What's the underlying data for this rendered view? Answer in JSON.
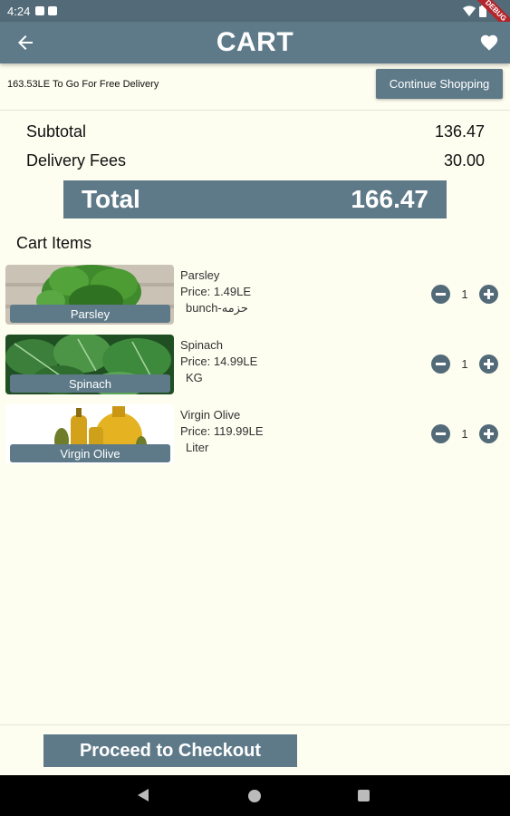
{
  "status_bar": {
    "time": "4:24"
  },
  "app_bar": {
    "title": "CART"
  },
  "promo": {
    "text": "163.53LE To Go For Free Delivery",
    "continue_label": "Continue Shopping"
  },
  "summary": {
    "subtotal_label": "Subtotal",
    "subtotal_value": "136.47",
    "delivery_label": "Delivery Fees",
    "delivery_value": "30.00",
    "total_label": "Total",
    "total_value": "166.47"
  },
  "cart": {
    "title": "Cart Items",
    "items": [
      {
        "name": "Parsley",
        "caption": "Parsley",
        "price": "Price: 1.49LE",
        "unit": "bunch-حزمه",
        "qty": "1"
      },
      {
        "name": "Spinach",
        "caption": "Spinach",
        "price": "Price: 14.99LE",
        "unit": "KG",
        "qty": "1"
      },
      {
        "name": "Virgin Olive",
        "caption": "Virgin Olive",
        "price": "Price: 119.99LE",
        "unit": "Liter",
        "qty": "1"
      }
    ]
  },
  "checkout": {
    "label": "Proceed to Checkout"
  },
  "colors": {
    "primary": "#5e7a89",
    "background": "#fdfdf0"
  },
  "icons": {
    "back": "arrow-left-icon",
    "favorite": "heart-icon"
  }
}
